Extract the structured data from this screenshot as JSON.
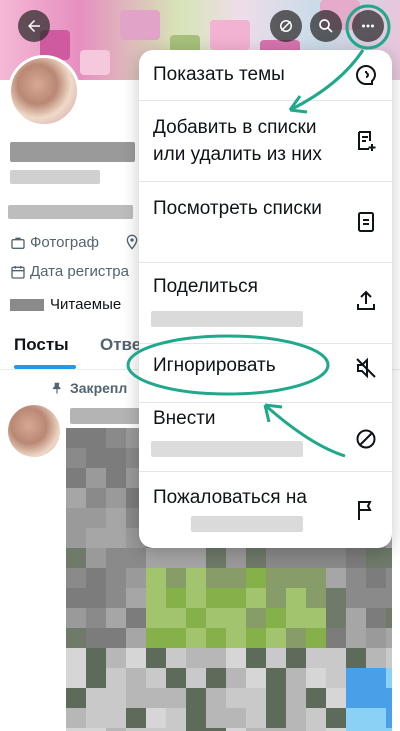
{
  "profile": {
    "occupation": "Фотограф",
    "joined": "Дата регистра",
    "following_label": "Читаемые"
  },
  "tabs": [
    {
      "label": "Посты"
    },
    {
      "label": "Отве"
    }
  ],
  "pinned_label": "Закрепл",
  "menu": {
    "items": [
      {
        "label": "Показать темы",
        "icon": "topics-icon"
      },
      {
        "label": "Добавить в списки или удалить из них",
        "icon": "list-add-icon"
      },
      {
        "label": "Посмотреть списки",
        "icon": "lists-icon"
      },
      {
        "label": "Поделиться",
        "icon": "share-icon"
      },
      {
        "label": "Игнорировать",
        "icon": "mute-icon"
      },
      {
        "label": "Внести",
        "icon": "block-icon"
      },
      {
        "label": "Пожаловаться на",
        "icon": "flag-icon"
      }
    ]
  },
  "colors": {
    "accent": "#1d9bf0",
    "annotation": "#1fa88a"
  }
}
